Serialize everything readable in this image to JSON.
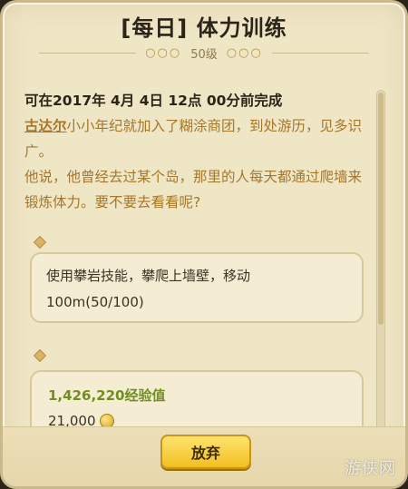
{
  "header": {
    "title": "[每日] 体力训练",
    "level": "50级"
  },
  "quest": {
    "complete_time": "可在2017年 4月 4日 12点 00分前完成",
    "npc_name": "古达尔",
    "story_line1": "小小年纪就加入了糊涂商团，到处游历，见多识广。",
    "story_line2": "他说，他曾经去过某个岛，那里的人每天都通过爬墙来锻炼体力。要不要去看看呢?"
  },
  "objective": {
    "line1": "使用攀岩技能，攀爬上墙壁，移动",
    "line2": "100m(50/100)"
  },
  "rewards": {
    "exp": "1,426,220经验值",
    "gold": "21,000"
  },
  "actions": {
    "abandon_label": "放弃"
  },
  "watermark": {
    "text": "游侠网"
  },
  "colors": {
    "panel_bg": "#efe6c6",
    "story_text": "#a5772a",
    "exp_text": "#6f8f1f",
    "button_gold": "#f2bf22"
  }
}
